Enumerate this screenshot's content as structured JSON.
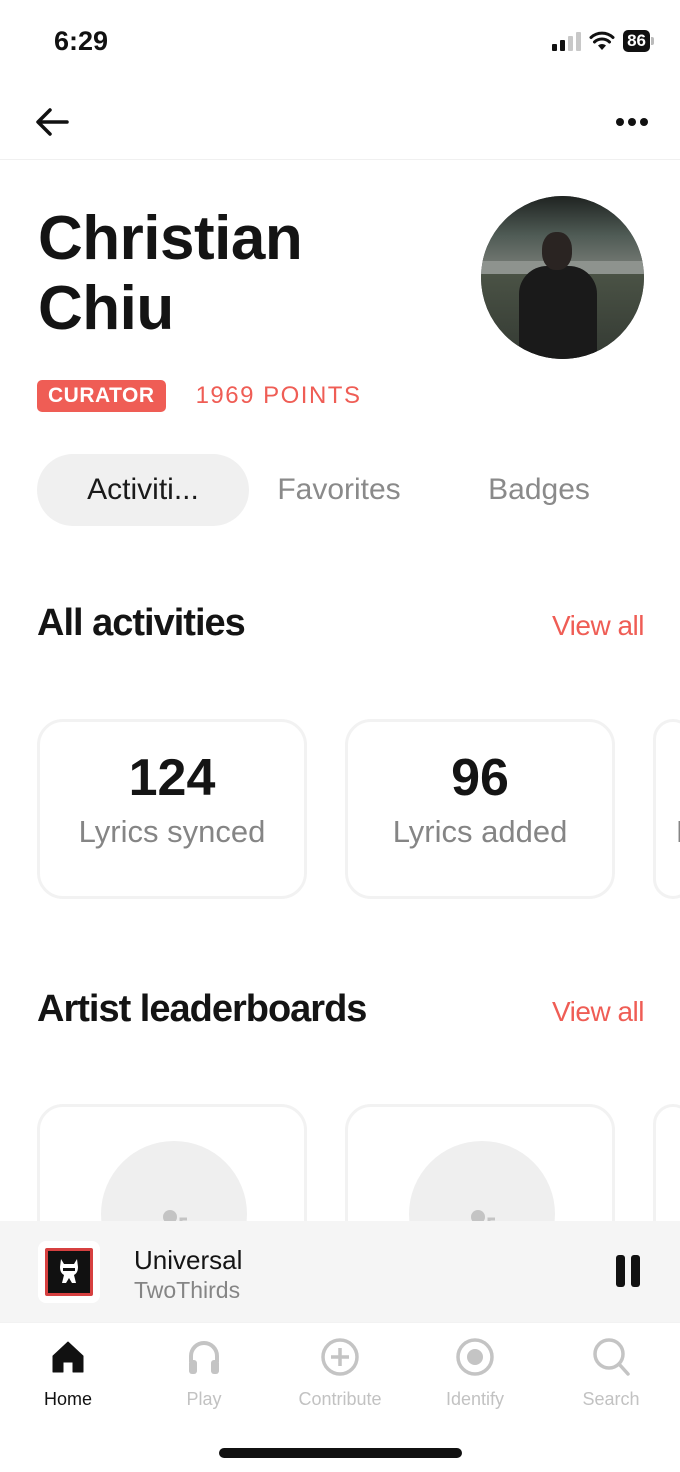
{
  "status_bar": {
    "time": "6:29",
    "battery": "86"
  },
  "profile": {
    "name": "Christian Chiu",
    "role_badge": "CURATOR",
    "points": "1969 POINTS",
    "accent_color": "#ef5d55"
  },
  "tabs": [
    {
      "label": "Activiti...",
      "active": true
    },
    {
      "label": "Favorites",
      "active": false
    },
    {
      "label": "Badges",
      "active": false
    }
  ],
  "activities": {
    "title": "All activities",
    "view_all": "View all",
    "stats": [
      {
        "value": "124",
        "label": "Lyrics synced"
      },
      {
        "value": "96",
        "label": "Lyrics added"
      },
      {
        "value": "",
        "label": "L"
      }
    ]
  },
  "leaderboards": {
    "title": "Artist leaderboards",
    "view_all": "View all"
  },
  "now_playing": {
    "title": "Universal",
    "artist": "TwoThirds"
  },
  "bottom_nav": [
    {
      "label": "Home",
      "icon": "home-icon",
      "active": true
    },
    {
      "label": "Play",
      "icon": "headphones-icon",
      "active": false
    },
    {
      "label": "Contribute",
      "icon": "plus-circle-icon",
      "active": false
    },
    {
      "label": "Identify",
      "icon": "identify-icon",
      "active": false
    },
    {
      "label": "Search",
      "icon": "search-icon",
      "active": false
    }
  ]
}
